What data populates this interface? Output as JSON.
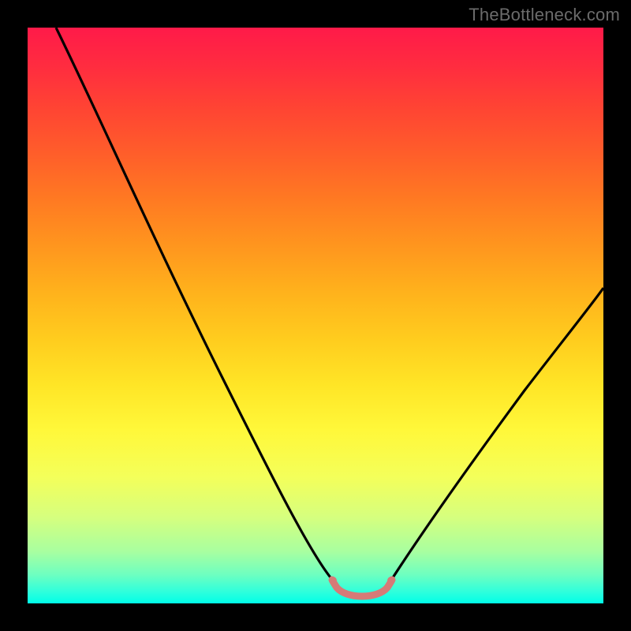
{
  "watermark": "TheBottleneck.com",
  "colors": {
    "frame": "#000000",
    "curve": "#000000",
    "trough_marker": "#d67a77",
    "gradient_top": "#ff1a49",
    "gradient_bottom": "#00ffe8"
  },
  "chart_data": {
    "type": "line",
    "title": "",
    "xlabel": "",
    "ylabel": "",
    "xlim": [
      0,
      100
    ],
    "ylim": [
      0,
      100
    ],
    "note": "Bottleneck-style V-curve over a vertical rainbow heat gradient. x is normalized horizontal position (0=left edge of plot area, 100=right). y is normalized vertical position (0=bottom/green, 100=top/red). Axes have no tick labels.",
    "series": [
      {
        "name": "curve-left",
        "x": [
          5,
          10,
          15,
          20,
          25,
          30,
          35,
          40,
          45,
          50,
          53
        ],
        "y": [
          100,
          93,
          85,
          77,
          68,
          59,
          49,
          38,
          26,
          12,
          4
        ]
      },
      {
        "name": "trough",
        "x": [
          53,
          55,
          57,
          59,
          61,
          63
        ],
        "y": [
          4,
          2,
          1.5,
          1.5,
          2,
          4
        ]
      },
      {
        "name": "curve-right",
        "x": [
          63,
          68,
          73,
          78,
          83,
          88,
          93,
          98,
          100
        ],
        "y": [
          4,
          10,
          17,
          24,
          31,
          38,
          45,
          52,
          55
        ]
      }
    ],
    "trough_highlight": {
      "x_start": 53,
      "x_end": 63,
      "y": 2.5,
      "color": "#d67a77"
    }
  }
}
